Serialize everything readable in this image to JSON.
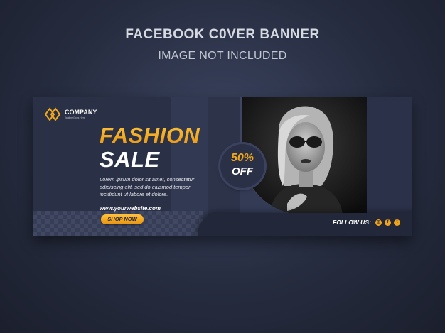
{
  "header": {
    "title": "FACEBOOK C0VER BANNER",
    "subtitle": "IMAGE NOT INCLUDED"
  },
  "banner": {
    "logo": {
      "name": "COMPANY",
      "tagline": "Tagline Goes Here",
      "icon": "diamond-logo-icon"
    },
    "headline_1": "FASHION",
    "headline_2": "SALE",
    "body": "Lorem ipsum dolor sit amet, consectetur adipiscing elit, sed do eiusmod tempor incididunt ut labore et dolore.",
    "website": "www.yourwebsite.com",
    "cta_label": "SHOP NOW",
    "badge": {
      "percent": "50%",
      "off": "OFF"
    },
    "follow_label": "FOLLOW US:",
    "social_icons": [
      "instagram-icon",
      "facebook-icon",
      "twitter-icon"
    ]
  },
  "colors": {
    "accent": "#f3a81a",
    "banner_bg": "#2a3046",
    "page_bg": "#262c3f"
  }
}
